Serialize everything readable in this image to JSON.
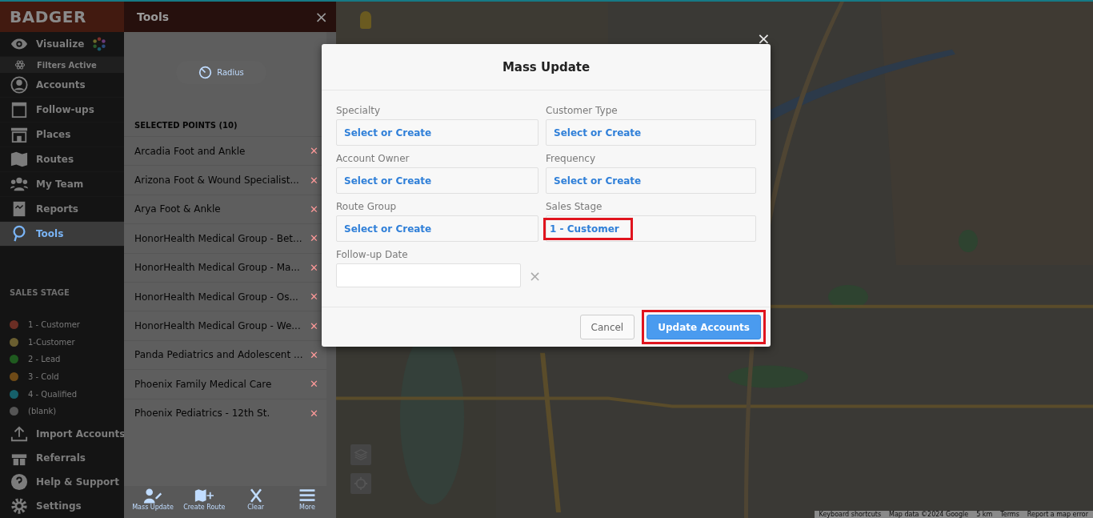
{
  "sidebar": {
    "logo": "BADGER",
    "items": [
      {
        "label": "Visualize",
        "selected": false
      },
      {
        "label": "Accounts",
        "selected": false
      },
      {
        "label": "Follow-ups",
        "selected": false
      },
      {
        "label": "Places",
        "selected": false
      },
      {
        "label": "Routes",
        "selected": false
      },
      {
        "label": "My Team",
        "selected": false
      },
      {
        "label": "Reports",
        "selected": false
      },
      {
        "label": "Tools",
        "selected": true
      }
    ],
    "filters_status": "Filters Active",
    "legend": {
      "title": "SALES STAGE",
      "items": [
        {
          "label": "1 - Customer",
          "color": "#6b2e24"
        },
        {
          "label": "1-Customer",
          "color": "#6a5e30"
        },
        {
          "label": "2 - Lead",
          "color": "#1f5a1f"
        },
        {
          "label": "3 - Cold",
          "color": "#6e4a17"
        },
        {
          "label": "4 - Qualified",
          "color": "#16606a"
        },
        {
          "label": "(blank)",
          "color": "#555555"
        }
      ]
    },
    "bottom_items": [
      {
        "label": "Import Accounts"
      },
      {
        "label": "Referrals"
      },
      {
        "label": "Help & Support"
      },
      {
        "label": "Settings"
      }
    ]
  },
  "tools_panel": {
    "title": "Tools",
    "close": "×",
    "radius_button": "Radius",
    "selected_heading": "SELECTED POINTS (10)",
    "remove_mark": "✕",
    "points": [
      "Arcadia Foot and Ankle",
      "Arizona Foot & Wound Specialist...",
      "Arya Foot & Ankle",
      "HonorHealth Medical Group - Bet...",
      "HonorHealth Medical Group - Ma...",
      "HonorHealth Medical Group - Os...",
      "HonorHealth Medical Group - We...",
      "Panda Pediatrics and Adolescent ...",
      "Phoenix Family Medical Care",
      "Phoenix Pediatrics - 12th St."
    ],
    "toolbar": [
      {
        "label": "Mass Update"
      },
      {
        "label": "Create Route"
      },
      {
        "label": "Clear"
      },
      {
        "label": "More"
      }
    ]
  },
  "map": {
    "kind": "picture",
    "attribution": [
      "Keyboard shortcuts",
      "Map data ©2024 Google",
      "5 km",
      "Terms",
      "Report a map error"
    ]
  },
  "modal": {
    "title": "Mass Update",
    "close": "×",
    "fields": [
      {
        "label": "Specialty",
        "value": "Select or Create",
        "highlighted": false
      },
      {
        "label": "Customer Type",
        "value": "Select or Create",
        "highlighted": false
      },
      {
        "label": "Account Owner",
        "value": "Select or Create",
        "highlighted": false
      },
      {
        "label": "Frequency",
        "value": "Select or Create",
        "highlighted": false
      },
      {
        "label": "Route Group",
        "value": "Select or Create",
        "highlighted": false
      },
      {
        "label": "Sales Stage",
        "value": "1 - Customer",
        "highlighted": true
      }
    ],
    "date_field": {
      "label": "Follow-up Date",
      "clear": "×"
    },
    "buttons": [
      {
        "label": "Cancel",
        "kind": "secondary",
        "highlighted": false
      },
      {
        "label": "Update Accounts",
        "kind": "primary",
        "highlighted": true
      }
    ]
  }
}
